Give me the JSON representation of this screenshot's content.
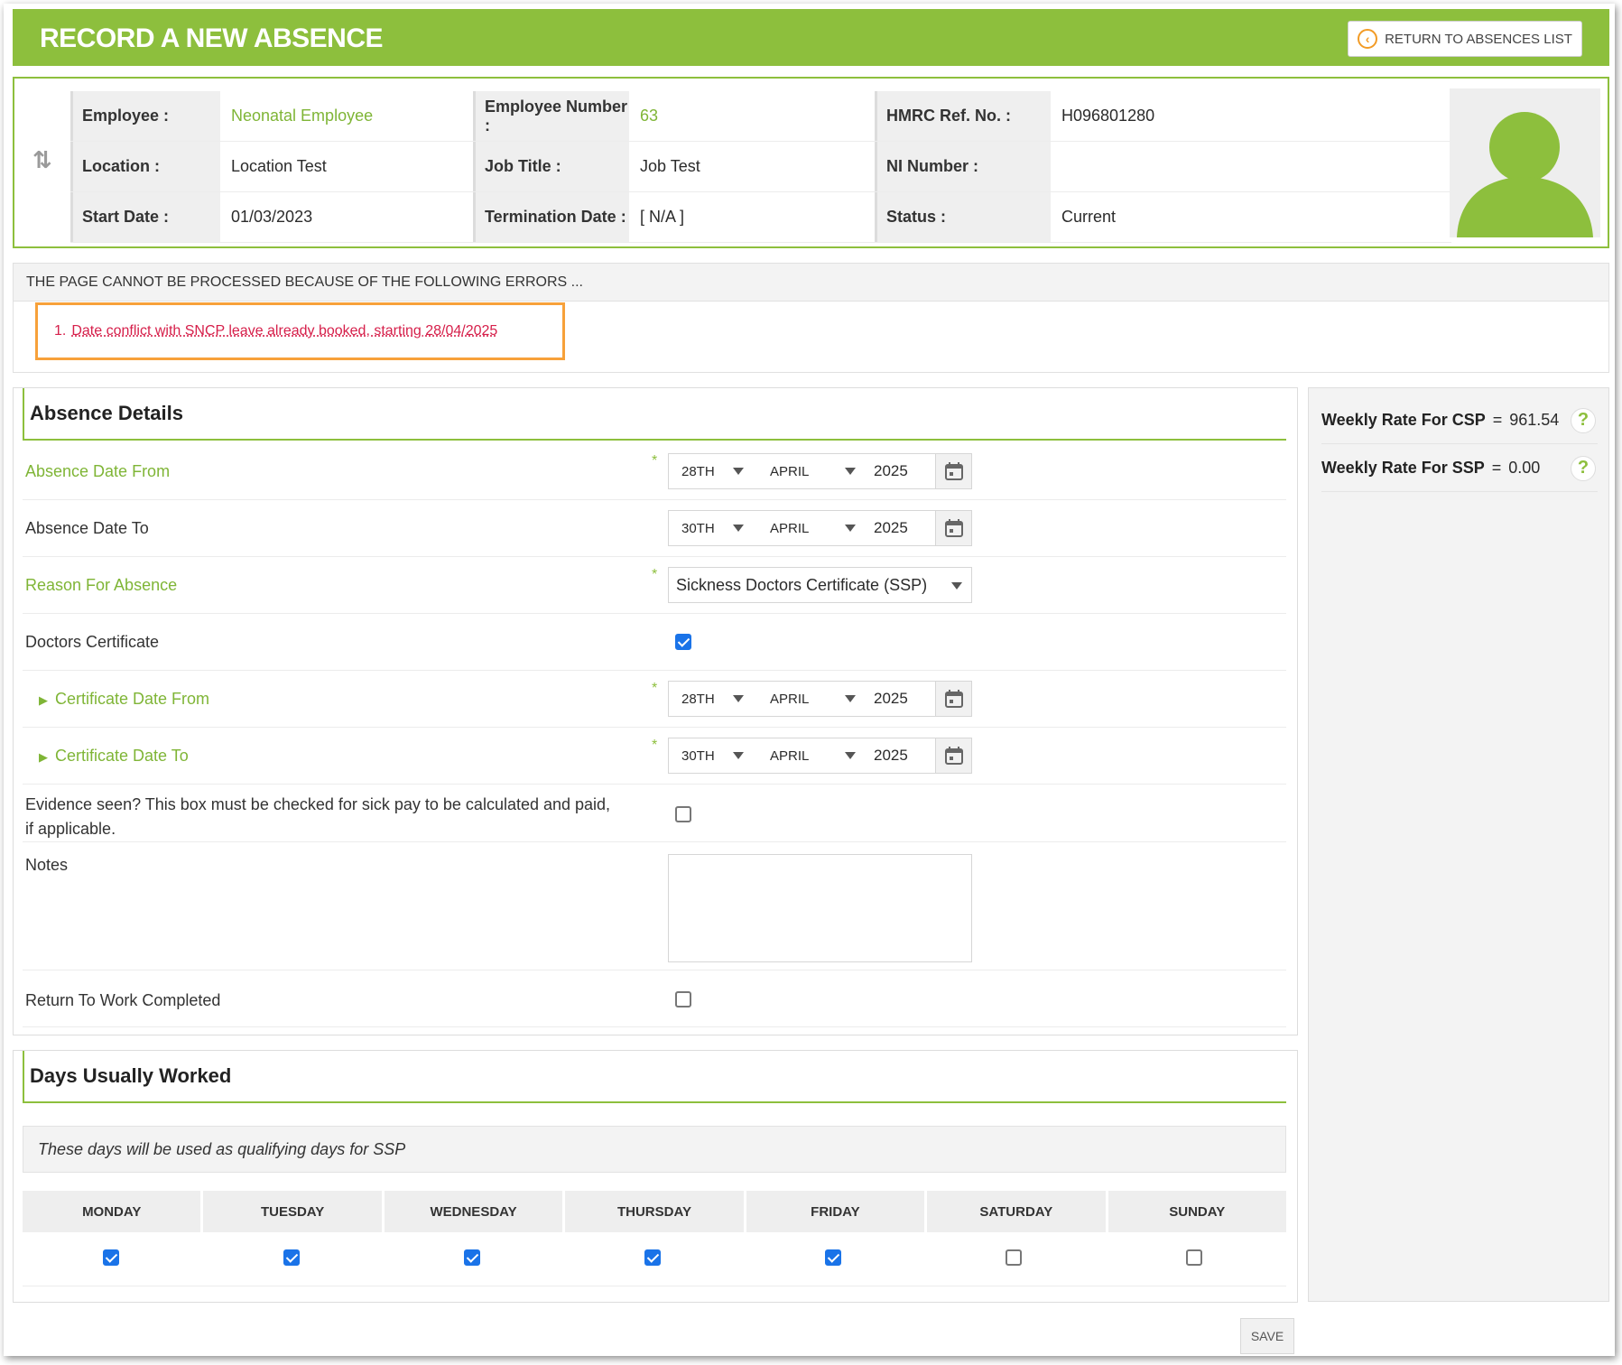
{
  "header": {
    "title": "RECORD A NEW ABSENCE",
    "return_label": "RETURN TO ABSENCES LIST"
  },
  "employee": {
    "rows": [
      [
        {
          "label": "Employee :",
          "value": "Neonatal Employee",
          "value_green": true
        },
        {
          "label": "Employee Number :",
          "value": "63",
          "value_green": true
        },
        {
          "label": "HMRC Ref. No. :",
          "value": "H096801280",
          "value_green": false
        }
      ],
      [
        {
          "label": "Location :",
          "value": "Location Test",
          "value_green": false
        },
        {
          "label": "Job Title :",
          "value": "Job Test",
          "value_green": false
        },
        {
          "label": "NI Number :",
          "value": "",
          "value_green": false
        }
      ],
      [
        {
          "label": "Start Date :",
          "value": "01/03/2023",
          "value_green": false
        },
        {
          "label": "Termination Date :",
          "value": "[ N/A ]",
          "value_green": false
        },
        {
          "label": "Status :",
          "value": "Current",
          "value_green": false
        }
      ]
    ]
  },
  "errors": {
    "heading": "THE PAGE CANNOT BE PROCESSED BECAUSE OF THE FOLLOWING ERRORS ...",
    "items": [
      {
        "number": "1.",
        "text": "Date conflict with SNCP leave already booked, starting 28/04/2025"
      }
    ]
  },
  "absence": {
    "title": "Absence Details",
    "date_from": {
      "label": "Absence Date From",
      "day": "28TH",
      "month": "APRIL",
      "year": "2025"
    },
    "date_to": {
      "label": "Absence Date To",
      "day": "30TH",
      "month": "APRIL",
      "year": "2025"
    },
    "reason": {
      "label": "Reason For Absence",
      "value": "Sickness Doctors Certificate (SSP)"
    },
    "doctors_cert": {
      "label": "Doctors Certificate",
      "checked": true
    },
    "cert_from": {
      "label": "Certificate Date From",
      "day": "28TH",
      "month": "APRIL",
      "year": "2025"
    },
    "cert_to": {
      "label": "Certificate Date To",
      "day": "30TH",
      "month": "APRIL",
      "year": "2025"
    },
    "evidence": {
      "label_line1": "Evidence seen? This box must be checked for sick pay to be calculated and paid,",
      "label_line2": "if applicable.",
      "checked": false
    },
    "notes": {
      "label": "Notes",
      "value": ""
    },
    "rtw": {
      "label": "Return To Work Completed",
      "checked": false
    },
    "required_mark": "*"
  },
  "rates": {
    "csp": {
      "label": "Weekly Rate For CSP",
      "eq": "=",
      "value": "961.54"
    },
    "ssp": {
      "label": "Weekly Rate For SSP",
      "eq": "=",
      "value": "0.00"
    },
    "help_glyph": "?"
  },
  "days": {
    "title": "Days Usually Worked",
    "note": "These days will be used as qualifying days for SSP",
    "items": [
      {
        "name": "MONDAY",
        "checked": true
      },
      {
        "name": "TUESDAY",
        "checked": true
      },
      {
        "name": "WEDNESDAY",
        "checked": true
      },
      {
        "name": "THURSDAY",
        "checked": true
      },
      {
        "name": "FRIDAY",
        "checked": true
      },
      {
        "name": "SATURDAY",
        "checked": false
      },
      {
        "name": "SUNDAY",
        "checked": false
      }
    ]
  },
  "save_label": "SAVE",
  "colors": {
    "brand_green": "#8dbf3d",
    "error_red": "#d6204b",
    "highlight_orange": "#f7a13a",
    "checkbox_blue": "#1a73e8"
  }
}
